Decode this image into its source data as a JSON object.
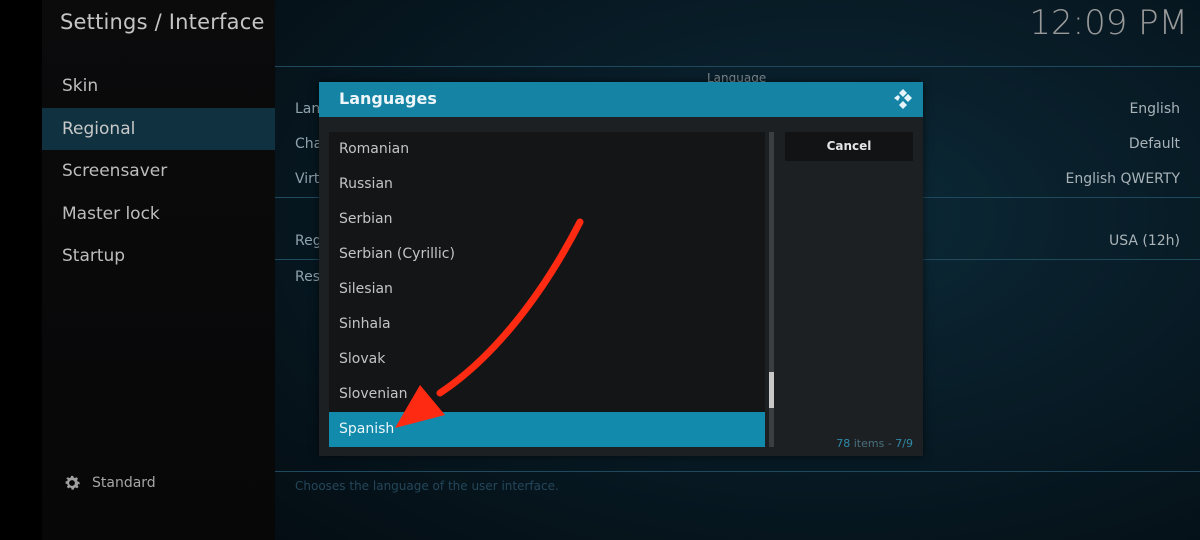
{
  "header": {
    "title": "Settings / Interface",
    "clock": "12:09 PM"
  },
  "sidebar": {
    "items": [
      {
        "label": "Skin",
        "active": false
      },
      {
        "label": "Regional",
        "active": true
      },
      {
        "label": "Screensaver",
        "active": false
      },
      {
        "label": "Master lock",
        "active": false
      },
      {
        "label": "Startup",
        "active": false
      }
    ],
    "level": {
      "icon": "gear-icon",
      "label": "Standard"
    }
  },
  "settings": {
    "section_header": "Language",
    "rows": [
      {
        "label": "Lan",
        "value": "English"
      },
      {
        "label": "Cha",
        "value": "Default"
      },
      {
        "label": "Virt",
        "value": "English QWERTY"
      },
      {
        "label": "Reg",
        "value": "USA (12h)"
      },
      {
        "label": "Res",
        "value": ""
      }
    ],
    "help_text": "Chooses the language of the user interface."
  },
  "dialog": {
    "title": "Languages",
    "logo_icon": "kodi-logo-icon",
    "items": [
      {
        "label": "Romanian",
        "selected": false
      },
      {
        "label": "Russian",
        "selected": false
      },
      {
        "label": "Serbian",
        "selected": false
      },
      {
        "label": "Serbian (Cyrillic)",
        "selected": false
      },
      {
        "label": "Silesian",
        "selected": false
      },
      {
        "label": "Sinhala",
        "selected": false
      },
      {
        "label": "Slovak",
        "selected": false
      },
      {
        "label": "Slovenian",
        "selected": false
      },
      {
        "label": "Spanish",
        "selected": true
      }
    ],
    "cancel_label": "Cancel",
    "item_count": "78",
    "items_word": "items",
    "page_separator": " - ",
    "page": "7/9",
    "scroll_position": 0.86
  },
  "annotation": {
    "type": "red-arrow",
    "color": "#ff2a12",
    "points_to": "Spanish"
  }
}
